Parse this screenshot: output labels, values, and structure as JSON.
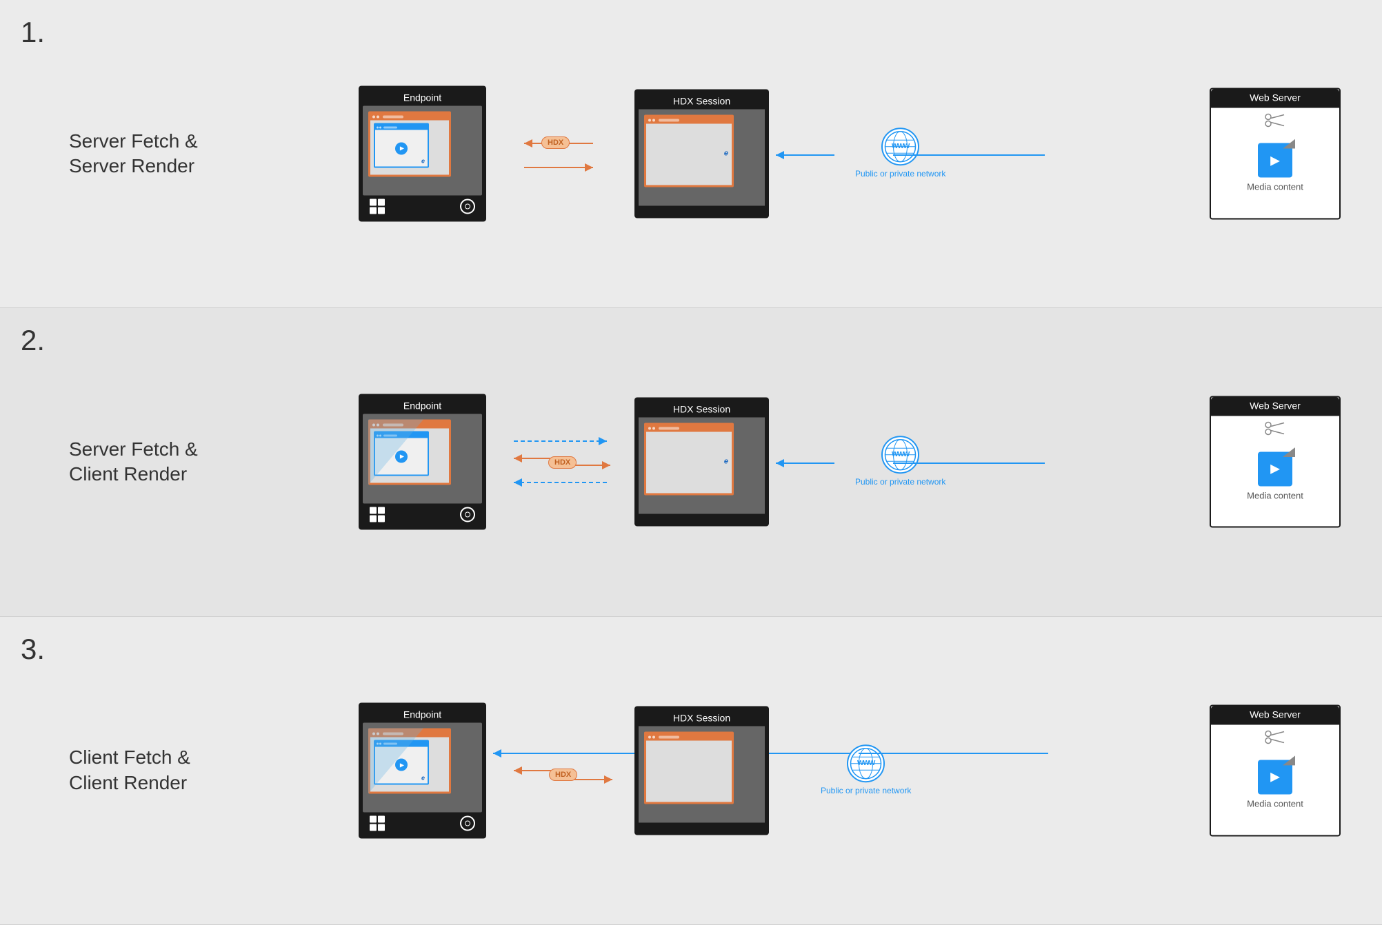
{
  "scenarios": [
    {
      "number": "1.",
      "title": "Server Fetch & Server Render",
      "endpoint_label": "Endpoint",
      "hdx_label": "HDX Session",
      "webserver_label": "Web Server",
      "media_label": "Media content",
      "network_label": "Public or private network",
      "hdx_pill": "HDX"
    },
    {
      "number": "2.",
      "title": "Server Fetch & Client Render",
      "endpoint_label": "Endpoint",
      "hdx_label": "HDX Session",
      "webserver_label": "Web Server",
      "media_label": "Media content",
      "network_label": "Public or private network",
      "hdx_pill": "HDX"
    },
    {
      "number": "3.",
      "title": "Client Fetch & Client Render",
      "endpoint_label": "Endpoint",
      "hdx_label": "HDX Session",
      "webserver_label": "Web Server",
      "media_label": "Media content",
      "network_label": "Public or private network",
      "hdx_pill": "HDX"
    }
  ],
  "colors": {
    "orange": "#e07840",
    "blue": "#2196F3",
    "dark": "#1a1a1a",
    "white": "#ffffff"
  }
}
